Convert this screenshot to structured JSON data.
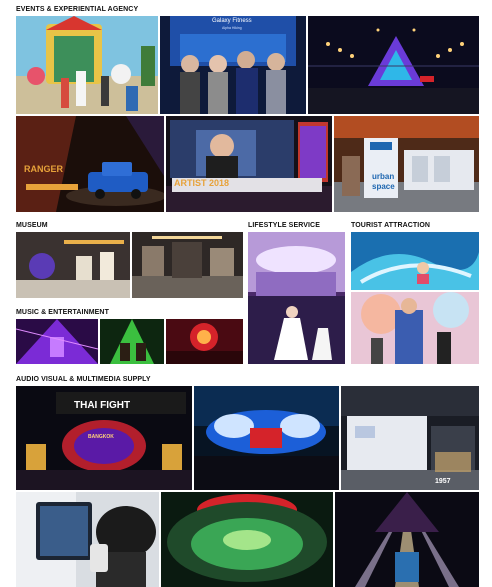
{
  "sections": {
    "events": "EVENTS & EXPERIENTIAL AGENCY",
    "museum": "MUSEUM",
    "lifestyle": "LIFESTYLE SERVICE",
    "tourist": "TOURIST ATTRACTION",
    "music": "MUSIC & ENTERTAINMENT",
    "audio": "AUDIO VISUAL & MULTIMEDIA SUPPLY"
  },
  "photos": {
    "galaxy_title": "Galaxy Fitness",
    "galaxy_sub": "Alpha Hiking",
    "ranger": "RANGER",
    "artist_event": "ARTIST 2018",
    "urban": "urban",
    "space": "space",
    "thai_fight": "THAI FIGHT",
    "bangkok": "BANGKOK",
    "year": "1957"
  },
  "colors": {
    "heading": "#111111",
    "stage_purple": "#7b2bd6",
    "stage_blue": "#1c5fd8",
    "stage_red": "#d5232a",
    "warm_gold": "#e7a23a"
  }
}
